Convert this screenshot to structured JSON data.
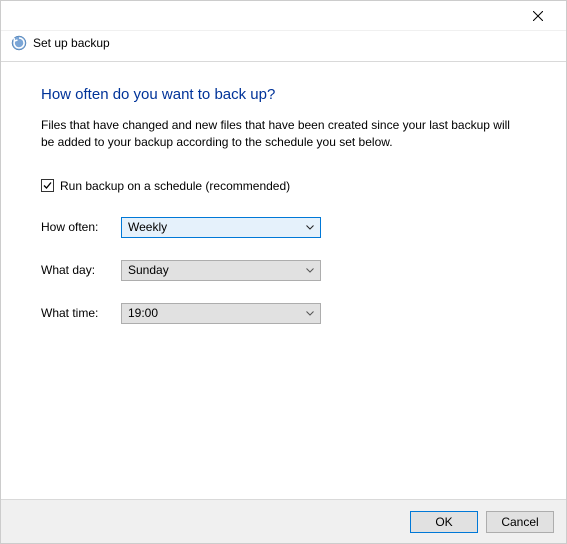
{
  "window": {
    "title": "Set up backup"
  },
  "main": {
    "heading": "How often do you want to back up?",
    "description": "Files that have changed and new files that have been created since your last backup will be added to your backup according to the schedule you set below."
  },
  "form": {
    "schedule_checkbox_label": "Run backup on a schedule (recommended)",
    "schedule_checked": true,
    "how_often_label": "How often:",
    "how_often_value": "Weekly",
    "what_day_label": "What day:",
    "what_day_value": "Sunday",
    "what_time_label": "What time:",
    "what_time_value": "19:00"
  },
  "footer": {
    "ok_label": "OK",
    "cancel_label": "Cancel"
  }
}
